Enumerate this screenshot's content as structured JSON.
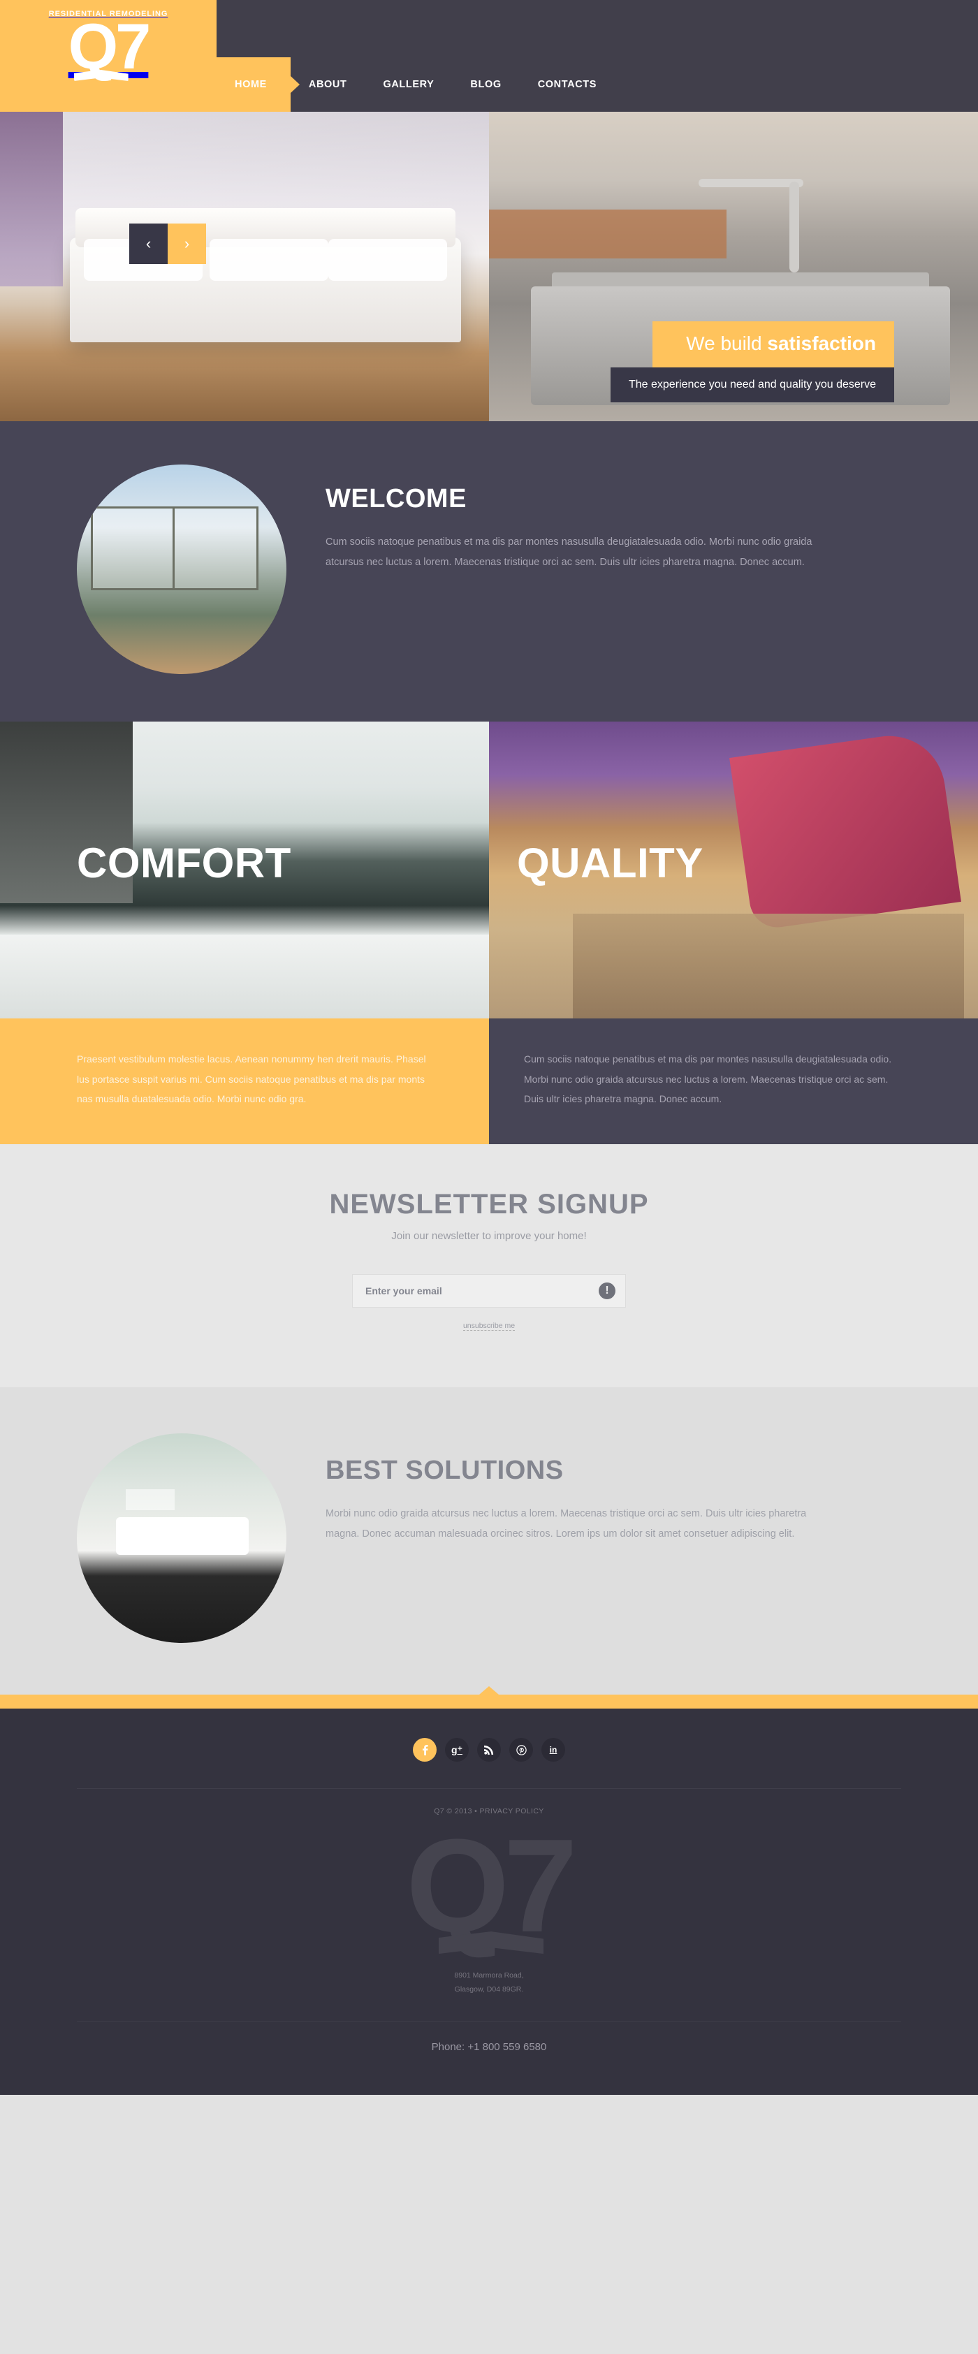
{
  "brand": {
    "tagline": "RESIDENTIAL REMODELING",
    "name": "Q7",
    "accent": "#ffc35c",
    "dark": "#413f4b"
  },
  "nav": {
    "items": [
      {
        "label": "HOME",
        "active": true
      },
      {
        "label": "ABOUT",
        "active": false
      },
      {
        "label": "GALLERY",
        "active": false
      },
      {
        "label": "BLOG",
        "active": false
      },
      {
        "label": "CONTACTS",
        "active": false
      }
    ]
  },
  "slider": {
    "prev_icon": "chevron-left-icon",
    "next_icon": "chevron-right-icon",
    "prev_glyph": "‹",
    "next_glyph": "›",
    "caption_lead": "We build ",
    "caption_strong": "satisfaction",
    "caption_sub": "The experience you need and quality you deserve"
  },
  "welcome": {
    "title": "WELCOME",
    "text": "Cum sociis natoque penatibus et ma dis par montes nasusulla deugiatalesuada odio. Morbi nunc odio graida atcursus nec luctus a lorem. Maecenas tristique orci ac sem. Duis ultr icies pharetra magna. Donec accum."
  },
  "panels": [
    {
      "title": "COMFORT",
      "text": "Praesent vestibulum molestie lacus. Aenean nonummy hen drerit mauris. Phasel lus portasce suspit varius mi. Cum sociis natoque penatibus et ma dis par monts nas musulla duatalesuada odio. Morbi nunc odio gra."
    },
    {
      "title": "QUALITY",
      "text": "Cum sociis natoque penatibus et ma dis par montes nasusulla deugiatalesuada odio. Morbi nunc odio graida atcursus nec luctus a lorem. Maecenas tristique orci ac sem. Duis ultr icies pharetra magna. Donec accum."
    }
  ],
  "newsletter": {
    "title": "NEWSLETTER SIGNUP",
    "subtitle": "Join our newsletter to improve your home!",
    "input_value": "",
    "placeholder": "Enter your email",
    "submit_icon": "exclamation-icon",
    "submit_glyph": "!",
    "unsubscribe_label": "unsubscribe me"
  },
  "best": {
    "title": "BEST SOLUTIONS",
    "text": "Morbi nunc odio graida atcursus nec luctus a lorem. Maecenas tristique orci ac sem. Duis ultr icies pharetra magna. Donec accuman malesuada orcinec sitros. Lorem ips um dolor sit amet consetuer adipiscing elit."
  },
  "footer": {
    "socials": [
      {
        "name": "facebook-icon",
        "glyph": "f",
        "active": true
      },
      {
        "name": "google-plus-icon",
        "glyph": "g⁺",
        "active": false
      },
      {
        "name": "rss-icon",
        "glyph": "◔",
        "active": false
      },
      {
        "name": "pinterest-icon",
        "glyph": "℗",
        "active": false
      },
      {
        "name": "linkedin-icon",
        "glyph": "in",
        "active": false
      }
    ],
    "copyright": "Q7 © 2013 • PRIVACY POLICY",
    "watermark": "Q7",
    "address_line1": "8901 Marmora Road,",
    "address_line2": "Glasgow, D04 89GR.",
    "phone": "Phone:  +1 800 559 6580"
  }
}
